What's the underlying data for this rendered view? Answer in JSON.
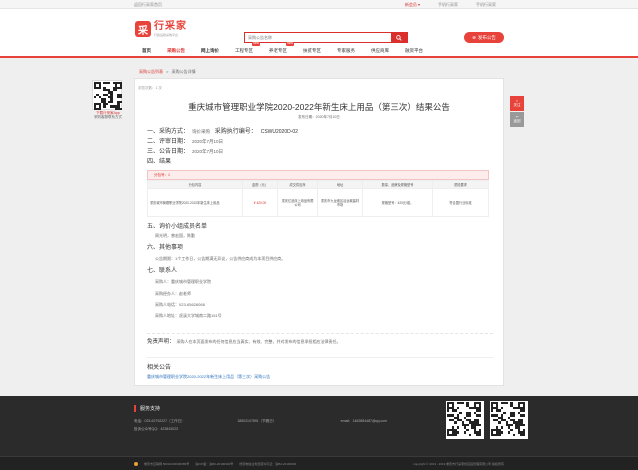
{
  "topbar": {
    "home_link": "返回行采家首页",
    "register": "新会员 ▾",
    "phone": "手机行采家",
    "mobile": "手机行采家"
  },
  "header": {
    "logo_mark": "采",
    "logo_title": "行采家",
    "logo_sub": "行政后勤采购平台",
    "search_placeholder": "采购公告名称",
    "publish_label": "发布公告"
  },
  "nav": {
    "items": [
      {
        "label": "首页",
        "tag": ""
      },
      {
        "label": "采购公告",
        "tag": ""
      },
      {
        "label": "网上询价",
        "tag": ""
      },
      {
        "label": "工程专区",
        "tag": "NEW"
      },
      {
        "label": "养老专区",
        "tag": "NEW"
      },
      {
        "label": "扶贫专区",
        "tag": ""
      },
      {
        "label": "专家服务",
        "tag": ""
      },
      {
        "label": "供应商库",
        "tag": ""
      },
      {
        "label": "融资平台",
        "tag": ""
      }
    ]
  },
  "breadcrumb": {
    "root": "采购公告列表",
    "sep": ">",
    "current": "采购公告详情"
  },
  "doc": {
    "browse": "浏览次数：1 次",
    "title": "重庆城市管理职业学院2020-2022年新生床上用品（第三次）结果公告",
    "publish_date": "发布日期：2020年7月10日",
    "s1_label": "一、采购方式：",
    "s1_value": "询价采购",
    "s1_code_label": "采购执行编号：",
    "s1_code": "CSWU2020D-02",
    "s2_label": "二、评审日期：",
    "s2_value": "2020年7月10日",
    "s3_label": "三、公告日期：",
    "s3_value": "2020年7月10日",
    "s4_label": "四、结果",
    "group": "分包号：1",
    "table_headers": [
      "分包内容",
      "金额（元）",
      "成交供应商",
      "地址",
      "数量、品牌及规格型号",
      "质检要求"
    ],
    "table_row": {
      "content": "重庆城市管理职业学院2020-2022年新生床上用品",
      "amount": "¥ 420.00",
      "supplier": "重庆亿品床上用品有限公司",
      "address": "重庆市九龙坡区谷运城建材市场",
      "spec": "规格型号：420元/套。",
      "quality": "符合国行业标准"
    },
    "s5_label": "五、询价小组成员名单",
    "s5_value": "周光明，曾宏国，陈勤",
    "s6_label": "六、其他事项",
    "s6_value": "公告期限：1个工作日，公告期满无异议，公告供应商成为本项目供应商。",
    "s7_label": "七、联系人",
    "contact_unit": "采购人：重庆城市管理职业学院",
    "contact_person": "采购经办人：赵老师",
    "contact_phone": "采购人电话：023-65626068",
    "contact_address": "采购人地址：虎溪大学城南二路151号",
    "disclaimer_label": "免责声明：",
    "disclaimer_text": "采购人在本页面发布的任何信息应当真实、有效、完整，并对发布的信息承担相应法律责任。",
    "related_title": "相关公告",
    "related_link": "重庆城市管理职业学院2020-2022年新生床上用品（第三次）采购公告"
  },
  "float_left": {
    "caption": "下载行采家App",
    "caption2": "采购客服联系方式"
  },
  "side_tools": [
    {
      "label": "关注"
    },
    {
      "label": "返回"
    }
  ],
  "footer": {
    "title": "服务支持",
    "phone1": "电话：023-62792227（工作日）",
    "phone2": "18502107891（节假日）",
    "email": "email：1462884487@qq.com",
    "complaint": "投诉公众号QQ：422843023",
    "icp": "重庆市互联网 50010202000089号",
    "icp2": "渝ICP备：渝B2-20190004号",
    "license": "增值电信业务经营许可证：渝B2-20190004",
    "copyright": "copyright © 2013 - 2019 重庆市行采家供应链管理有限公司 版权所有"
  }
}
